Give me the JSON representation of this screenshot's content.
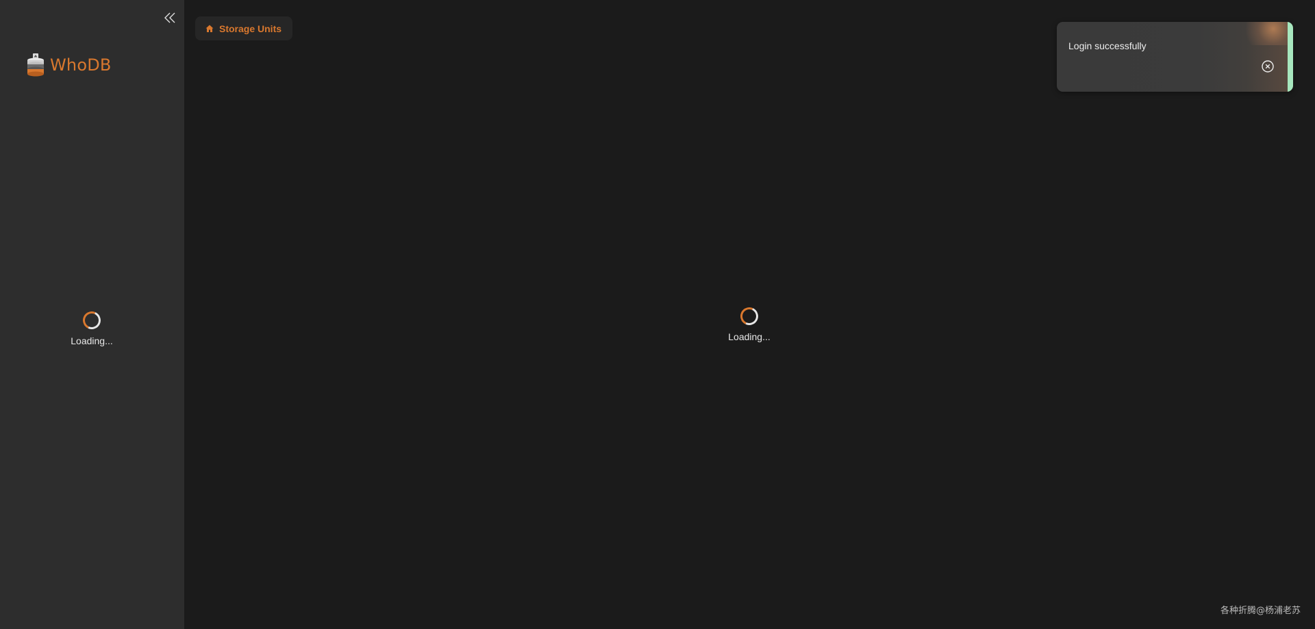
{
  "app": {
    "brand_name": "WhoDB",
    "logo_icon": "database-logo-icon",
    "collapse_icon": "double-chevron-left-icon"
  },
  "sidebar": {
    "loading_text": "Loading..."
  },
  "breadcrumb": {
    "icon": "home-icon",
    "label": "Storage Units"
  },
  "main": {
    "loading_text": "Loading..."
  },
  "toast": {
    "message": "Login successfully",
    "close_icon": "close-circle-icon",
    "accent_color": "#a7e7be"
  },
  "watermark": {
    "text": "各种折腾@杨浦老苏"
  },
  "colors": {
    "brand": "#d9782e",
    "sidebar_bg": "#2d2d2d",
    "main_bg": "#1b1b1b"
  }
}
